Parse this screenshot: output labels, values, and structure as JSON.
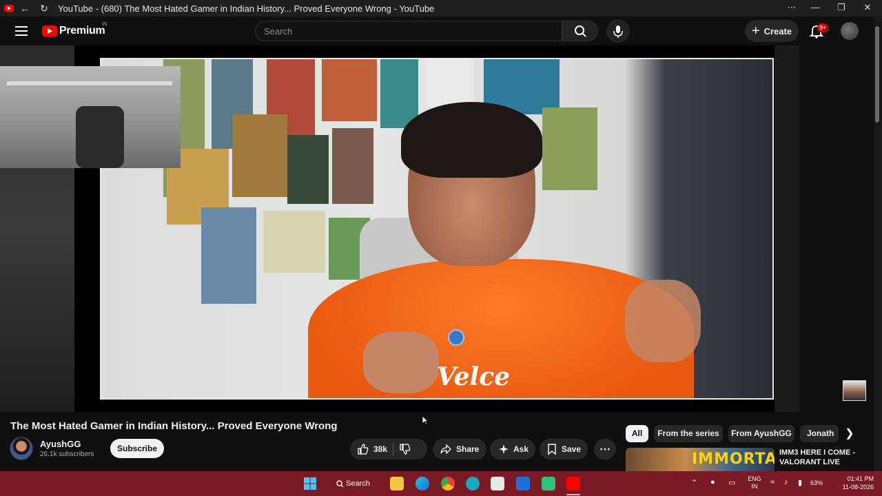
{
  "window": {
    "title": "YouTube - (680) The Most Hated Gamer in Indian History... Proved Everyone Wrong - YouTube"
  },
  "masthead": {
    "brand": "Premium",
    "country": "IN",
    "search_placeholder": "Search",
    "create_label": "Create",
    "notification_badge": "9+"
  },
  "video": {
    "title": "The Most Hated Gamer in Indian History... Proved Everyone Wrong",
    "channel_name": "AyushGG",
    "subscribers": "26.1k subscribers",
    "subscribe_label": "Subscribe",
    "like_count": "38k",
    "share_label": "Share",
    "ask_label": "Ask",
    "save_label": "Save",
    "shirt_text": "Velce"
  },
  "related": {
    "chips": [
      "All",
      "From the series",
      "From AyushGG",
      "Jonath"
    ],
    "first_title": "IMM3 HERE I COME - VALORANT LIVE",
    "first_thumb_text": "IMMORTAL"
  },
  "taskbar": {
    "search_label": "Search",
    "language": "ENG",
    "region": "IN",
    "battery": "63%",
    "time": "01:41 PM",
    "date": "11-08-2026"
  },
  "colors": {
    "accent": "#ff0000",
    "taskbar": "#7a1a24",
    "shirt": "#f26a1b"
  }
}
